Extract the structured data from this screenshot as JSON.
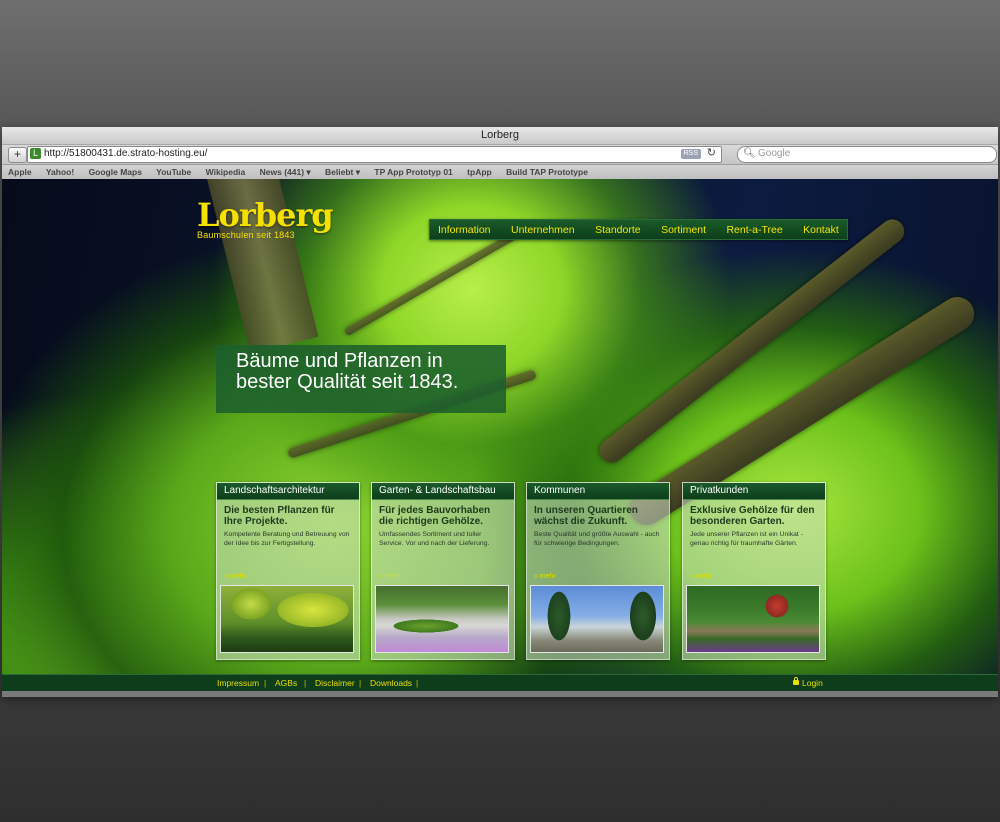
{
  "browser": {
    "window_title": "Lorberg",
    "add_button": "+",
    "url": "http://51800431.de.strato-hosting.eu/",
    "rss_label": "RSS",
    "search_placeholder": "Google",
    "bookmarks": [
      "Apple",
      "Yahoo!",
      "Google Maps",
      "YouTube",
      "Wikipedia",
      "News (441) ▾",
      "Beliebt ▾",
      "TP App Prototyp 01",
      "tpApp",
      "Build TAP Prototype"
    ]
  },
  "site": {
    "logo": {
      "word": "Lorberg",
      "tagline": "Baumschulen seit 1843"
    },
    "nav": [
      "Information",
      "Unternehmen",
      "Standorte",
      "Sortiment",
      "Rent-a-Tree",
      "Kontakt"
    ],
    "hero": {
      "line1": "Bäume und Pflanzen in",
      "line2": "bester Qualität seit 1843."
    },
    "cards": [
      {
        "header": "Landschaftsarchitektur",
        "title": "Die besten Pflanzen für Ihre Projekte.",
        "text": "Kompetente Beratung und Betreuung von der Idee bis zur Fertigstellung.",
        "more": "» mehr"
      },
      {
        "header": "Garten- & Landschaftsbau",
        "title": "Für jedes Bauvorhaben die richtigen Gehölze.",
        "text": "Umfassendes Sortiment und toller Service. Vor und nach der Lieferung.",
        "more": "» mehr"
      },
      {
        "header": "Kommunen",
        "title": "In unseren Quartieren wächst die Zukunft.",
        "text": "Beste Qualität und größte Auswahl - auch für schwierige Bedingungen.",
        "more": "» mehr"
      },
      {
        "header": "Privatkunden",
        "title": "Exklusive Gehölze für den besonderen Garten.",
        "text": "Jede unserer Pflanzen ist ein Unikat - genau richtig für traumhafte Gärten.",
        "more": "» mehr"
      }
    ],
    "footer": {
      "links": [
        "Impressum",
        "AGBs",
        "Disclaimer",
        "Downloads"
      ],
      "separator": "|",
      "login": "Login"
    }
  },
  "colors": {
    "brand_yellow": "#f5e000",
    "brand_green": "#0e3d1c"
  }
}
